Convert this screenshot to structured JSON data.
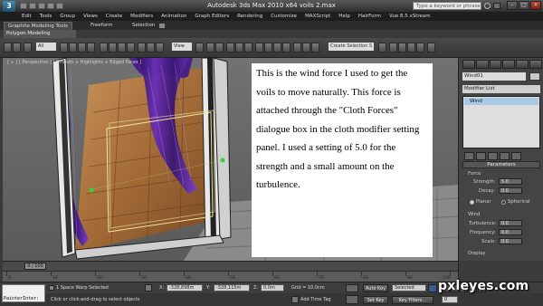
{
  "title_bar": {
    "title": "Autodesk 3ds Max  2010 x64     voils 2.max",
    "search_placeholder": "Type a keyword or phrase",
    "logo_text": "3"
  },
  "menu": [
    "Edit",
    "Tools",
    "Group",
    "Views",
    "Create",
    "Modifiers",
    "Animation",
    "Graph Editors",
    "Rendering",
    "Customize",
    "MAXScript",
    "Help",
    "HairForm",
    "Vue 8.5 xStream"
  ],
  "ribbon": {
    "tabs": [
      "Graphite Modeling Tools",
      "Freeform",
      "Selection"
    ],
    "active_panel": "Polygon Modeling"
  },
  "toolbar": {
    "selection_filter": "All",
    "reference_coord": "View",
    "named_selection": "Create Selection S"
  },
  "viewport": {
    "label": "[ + ] [ Perspective ] [ Smooth + Highlights + Edged Faces ]"
  },
  "annotation_text": "This is the wind force I used to get the voils to move naturally. This force is attached through the \"Cloth Forces\" dialogue box in the cloth modifier setting panel.  I used a setting of 5.0 for the strength and a small amount on the turbulence.",
  "command_panel": {
    "object_name": "Wind01",
    "modifier_list": "Modifier List",
    "stack_item": "Wind",
    "parameters_title": "Parameters",
    "force_group": "Force",
    "strength_label": "Strength:",
    "strength_value": "5.0",
    "decay_label": "Decay:",
    "decay_value": "0.0",
    "planar_label": "Planar",
    "spherical_label": "Spherical",
    "wind_group": "Wind",
    "turbulence_label": "Turbulence:",
    "turbulence_value": "0.0",
    "frequency_label": "Frequency:",
    "frequency_value": "0.0",
    "scale_label": "Scale:",
    "scale_value": "0.0",
    "display_group": "Display"
  },
  "timeline": {
    "frame_display": "0 / 100",
    "ticks": [
      "0",
      "10",
      "20",
      "30",
      "40",
      "50",
      "60",
      "70",
      "80",
      "90",
      "100"
    ]
  },
  "status": {
    "maxscript_label": "PainterInter:",
    "selected_text": "1 Space Warp Selected",
    "prompt_text": "Click or click-and-drag to select objects",
    "x_label": "X:",
    "x_value": "-328,898m",
    "y_label": "Y:",
    "y_value": "-328,115m",
    "z_label": "Z:",
    "z_value": "0.0m",
    "grid_text": "Grid = 10.0cm",
    "add_time_tag": "Add Time Tag",
    "auto_key": "Auto Key",
    "selected_dropdown": "Selected",
    "set_key": "Set Key",
    "key_filters": "Key Filters...",
    "frame_field": "0"
  },
  "watermark": "pxleyes.com"
}
